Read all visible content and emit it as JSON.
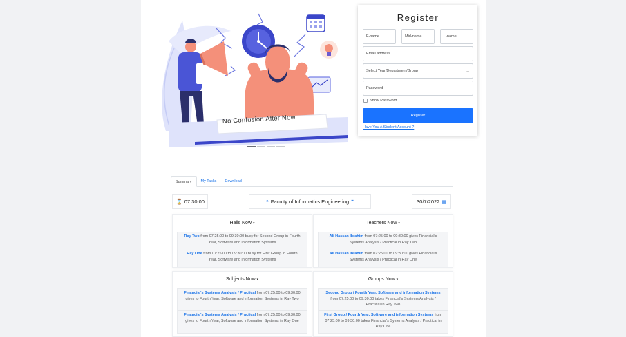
{
  "hero": {
    "caption": "No Confusion After Now",
    "slide_count": 4,
    "active_slide": 1
  },
  "register": {
    "title": "Register",
    "fname_placeholder": "F-name",
    "midname_placeholder": "Mid-name",
    "lname_placeholder": "L-name",
    "email_placeholder": "Email address",
    "select_placeholder": "Select Year/Department/Group",
    "password_placeholder": "Password",
    "show_password_label": "Show Password",
    "submit_label": "Register",
    "login_link": "Have You A Student Account ?"
  },
  "tabs": [
    {
      "label": "Summary",
      "active": true
    },
    {
      "label": "My Tasks",
      "active": false
    },
    {
      "label": "Download",
      "active": false
    }
  ],
  "info": {
    "time": "07:30:00",
    "faculty": "Faculty of Informatics Engineering",
    "date": "30/7/2022"
  },
  "panels": {
    "halls": {
      "title": "Halls Now",
      "items": [
        {
          "name": "Ray Two",
          "text": " from 07:25:00 to 09:30:00 busy for Second Group in Fourth Year, Software and information Systems"
        },
        {
          "name": "Ray One",
          "text": " from 07:25:00 to 09:30:00 busy for First Group in Fourth Year, Software and information Systems"
        }
      ]
    },
    "teachers": {
      "title": "Teachers Now",
      "items": [
        {
          "name": "Ali Hassan Ibrahim",
          "text": " from 07:25:00 to 09:30:00 gives Financial's Systems Analysis / Practical in Ray Two"
        },
        {
          "name": "Ali Hassan Ibrahim",
          "text": " from 07:25:00 to 09:30:00 gives Financial's Systems Analysis / Practical in Ray One"
        }
      ]
    },
    "subjects": {
      "title": "Subjects Now",
      "items": [
        {
          "name": "Financial's Systems Analysis / Practical",
          "text": " from 07:25:00 to 09:30:00 gives to Fourth Year, Software and information Systems in Ray Two"
        },
        {
          "name": "Financial's Systems Analysis / Practical",
          "text": " from 07:25:00 to 09:30:00 gives to Fourth Year, Software and information Systems in Ray One"
        }
      ]
    },
    "groups": {
      "title": "Groups Now",
      "items": [
        {
          "name": "Second Group / Fourth Year, Software and information Systems",
          "text": " from 07:25:00 to 09:30:00 takes Financial's Systems Analysis / Practical in Ray Two"
        },
        {
          "name": "First Group / Fourth Year, Software and information Systems",
          "text": " from 07:25:00 to 09:30:00 takes Financial's Systems Analysis / Practical in Ray One"
        }
      ]
    }
  },
  "colors": {
    "accent": "#1a73ff",
    "link": "#1a73e8",
    "illustration_primary": "#4a55d6",
    "illustration_skin": "#f4907a"
  },
  "icons": {
    "time": "hourglass-icon",
    "faculty": "quote-icon",
    "date": "calendar-icon",
    "select": "chevron-down-icon"
  }
}
